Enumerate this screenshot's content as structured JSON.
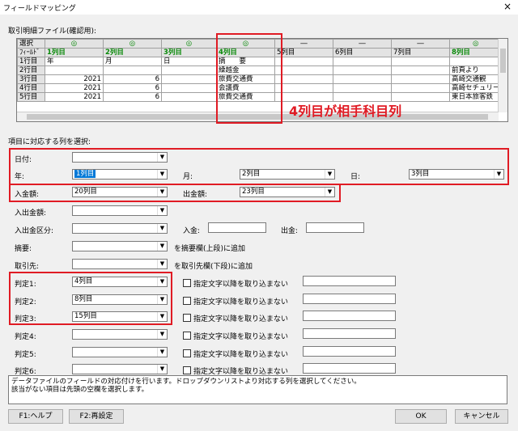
{
  "window": {
    "title": "フィールドマッピング",
    "close": "×"
  },
  "section_label": "取引明細ファイル(確認用):",
  "grid": {
    "corner_select": "選択",
    "corner_field": "ﾌｨｰﾙﾄﾞ",
    "select_marks": [
      "◎",
      "◎",
      "◎",
      "◎",
      "―",
      "―",
      "―",
      "◎"
    ],
    "fields": [
      "1列目",
      "2列目",
      "3列目",
      "4列目",
      "5列目",
      "6列目",
      "7列目",
      "8列目"
    ],
    "rows": [
      {
        "label": "1行目",
        "cells": [
          "年",
          "月",
          "日",
          "摘　　要",
          "",
          "",
          "",
          ""
        ]
      },
      {
        "label": "2行目",
        "cells": [
          "",
          "",
          "",
          "繰越金",
          "",
          "",
          "",
          "前頁より"
        ]
      },
      {
        "label": "3行目",
        "cells": [
          "2021",
          "6",
          "",
          "旅費交通費",
          "",
          "",
          "",
          "高崎交通観"
        ]
      },
      {
        "label": "4行目",
        "cells": [
          "2021",
          "6",
          "",
          "会議費",
          "",
          "",
          "",
          "高崎セチュリー"
        ]
      },
      {
        "label": "5行目",
        "cells": [
          "2021",
          "6",
          "",
          "旅費交通費",
          "",
          "",
          "",
          "東日本旅客鉄"
        ]
      }
    ],
    "annotation": "4列目が相手科目列"
  },
  "mapping_label": "項目に対応する列を選択:",
  "date": {
    "label": "日付:",
    "value": ""
  },
  "year": {
    "label": "年:",
    "value": "1列目"
  },
  "month": {
    "label": "月:",
    "value": "2列目"
  },
  "day": {
    "label": "日:",
    "value": "3列目"
  },
  "deposit": {
    "label": "入金額:",
    "value": "20列目"
  },
  "withdrawal": {
    "label": "出金額:",
    "value": "23列目"
  },
  "inout_amount": {
    "label": "入出金額:",
    "value": ""
  },
  "inout_type": {
    "label": "入出金区分:",
    "value": "",
    "in_label": "入金:",
    "out_label": "出金:"
  },
  "summary": {
    "label": "摘要:",
    "value": "",
    "note": "を摘要欄(上段)に追加"
  },
  "partner": {
    "label": "取引先:",
    "value": "",
    "note": "を取引先欄(下段)に追加"
  },
  "judges": [
    {
      "label": "判定1:",
      "value": "4列目",
      "check_label": "指定文字以降を取り込まない"
    },
    {
      "label": "判定2:",
      "value": "8列目",
      "check_label": "指定文字以降を取り込まない"
    },
    {
      "label": "判定3:",
      "value": "15列目",
      "check_label": "指定文字以降を取り込まない"
    },
    {
      "label": "判定4:",
      "value": "",
      "check_label": "指定文字以降を取り込まない"
    },
    {
      "label": "判定5:",
      "value": "",
      "check_label": "指定文字以降を取り込まない"
    },
    {
      "label": "判定6:",
      "value": "",
      "check_label": "指定文字以降を取り込まない"
    }
  ],
  "memo": {
    "line1": "データファイルのフィールドの対応付けを行います。ドロップダウンリストより対応する列を選択してください。",
    "line2": "該当がない項目は先頭の空欄を選択します。"
  },
  "buttons": {
    "help": "F1:ヘルプ",
    "reset": "F2:再設定",
    "ok": "OK",
    "cancel": "キャンセル"
  }
}
